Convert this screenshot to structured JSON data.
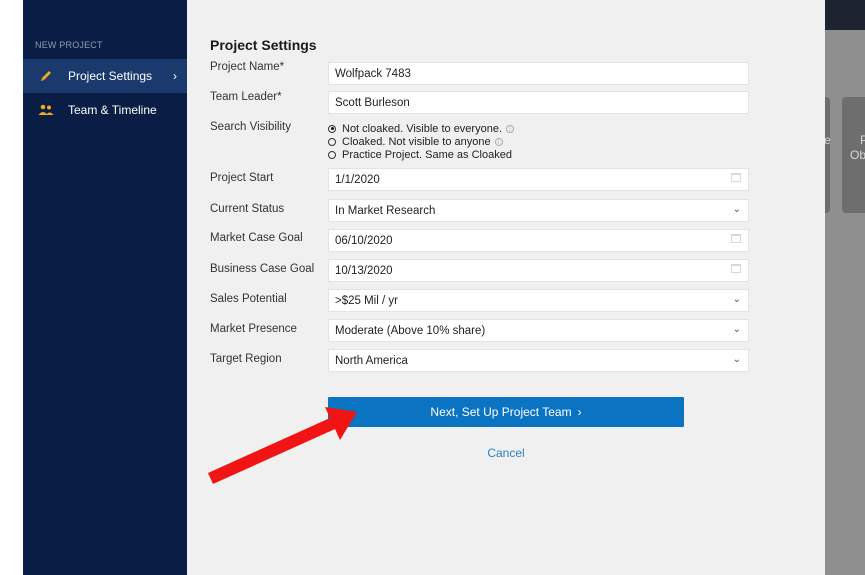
{
  "sidebar": {
    "section_title": "NEW PROJECT",
    "items": [
      {
        "label": "Project Settings",
        "icon": "pencil-icon",
        "active": true
      },
      {
        "label": "Team & Timeline",
        "icon": "people-icon",
        "active": false
      }
    ]
  },
  "modal": {
    "title": "Project Settings",
    "fields": {
      "project_name": {
        "label": "Project Name*",
        "value": "Wolfpack 7483"
      },
      "team_leader": {
        "label": "Team Leader*",
        "value": "Scott Burleson"
      },
      "search_visibility": {
        "label": "Search Visibility",
        "options": [
          {
            "label": "Not cloaked. Visible to everyone.",
            "selected": true,
            "info": true
          },
          {
            "label": "Cloaked. Not visible to anyone",
            "selected": false,
            "info": true
          },
          {
            "label": "Practice Project. Same as Cloaked",
            "selected": false,
            "info": false
          }
        ]
      },
      "project_start": {
        "label": "Project Start",
        "value": "1/1/2020"
      },
      "current_status": {
        "label": "Current Status",
        "value": "In Market Research"
      },
      "market_case_goal": {
        "label": "Market Case Goal",
        "value": "06/10/2020"
      },
      "business_case_goal": {
        "label": "Business Case Goal",
        "value": "10/13/2020"
      },
      "sales_potential": {
        "label": "Sales Potential",
        "value": ">$25 Mil / yr"
      },
      "market_presence": {
        "label": "Market Presence",
        "value": "Moderate (Above 10% share)"
      },
      "target_region": {
        "label": "Target Region",
        "value": "North America"
      }
    },
    "next_button": "Next, Set Up Project Team",
    "next_chevron": "›",
    "cancel": "Cancel"
  },
  "background": {
    "card_text_1": "e",
    "card_text_2a": "P",
    "card_text_2b": "Ob"
  },
  "colors": {
    "sidebar_bg": "#0a1e45",
    "sidebar_active": "#1a3a6d",
    "accent": "#0a74c2",
    "pencil": "#f5a623",
    "arrow": "#f01414"
  }
}
